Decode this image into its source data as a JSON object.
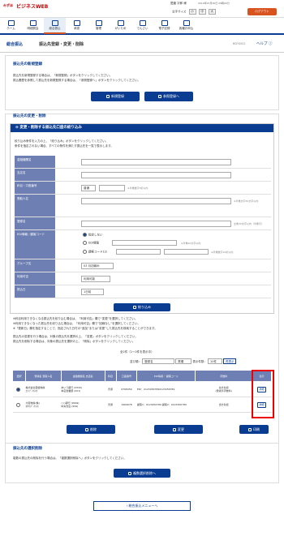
{
  "header": {
    "logo_sub": "みずほ",
    "logo": "ビジネスWEB",
    "user": "愛媛 次郎 様",
    "date": "2014年07月30日 09時00分",
    "font_size_label": "文字サイズ",
    "font_sizes": [
      "小",
      "中",
      "大"
    ],
    "logout": "ログアウト"
  },
  "nav": [
    "ホーム",
    "明細照会",
    "総合振込",
    "承認",
    "管理",
    "がいため",
    "でんさい",
    "電子記録",
    "各種お申込"
  ],
  "page": {
    "breadcrumb": "総合振込",
    "title": "振込先登録・変更・削除",
    "code": "BSFK002",
    "help": "ヘルプ"
  },
  "new_section": {
    "heading": "振込先の新規登録",
    "line1": "振込先を新規登録する場合は、「新規登録」ボタンをクリックしてください。",
    "line2": "振込履歴を参照して振込先を新規登録する場合は、「参照登録へ」ボタンをクリックしてください。",
    "btn_new": "新規登録",
    "btn_ref": "参照登録へ"
  },
  "edit_section": {
    "heading": "振込先の変更・削除",
    "filter_title": "変更・削除する振込先口座の絞り込み",
    "filter_line1": "絞り込み条件を入力の上、「絞り込み」ボタンをクリックしてください。",
    "filter_line2": "条件を指定されない場合、すべての条件を満たす振込先を一覧で表示します。",
    "fields": {
      "bank": "金融機関名",
      "branch": "支店名",
      "account_label": "科目・口座番号",
      "account_select": "普通",
      "account_note": "※半角数字7桁以内",
      "payee_name": "受取人名",
      "payee_note": "※半角文字30文字以内",
      "reg_name": "登録名",
      "reg_note": "全角30文字以内（半角可）",
      "edi_label": "EDI情報／顧客コード",
      "edi_opt1": "指定しない",
      "edi_opt2": "EDI情報",
      "edi_opt3": "顧客コード1/2",
      "edi_note2": "※半角20文字以内",
      "edi_note3": "※半角数字10桁以内",
      "group": "グループ名",
      "group_val": "03 月初締め",
      "usage": "利用可否",
      "usage_val": "利用可能",
      "transfer_date": "振込日",
      "transfer_val": "1日前"
    },
    "filter_btn": "絞り込み",
    "notice1": "※科目利用できなくなる振込先を絞り込む場合は、「利用可否」欄で“変更”を選択してください。",
    "notice2": "※利用できなくなった振込先を絞り込む場合は、「利用可否」欄で“回線なし”を選択してください。",
    "notice3": "※「更新日」欄を指定することで、指定された日付の“追加”または“変更”した振込先を検索することができます。",
    "select_line1": "振込先の変更を行う場合は、対象の振込先を選択の上、「変更」ボタンをクリックしてください。",
    "select_line2": "振込先を削除する場合は、対象の振込先を選択の上、「削除」ボタンをクリックしてください。",
    "count_text": "全2件（1～2件を表示中）",
    "sort_label": "並び順：",
    "sort_val": "登録名",
    "sort_dir": "昇順",
    "per_page_label": "表示件数：",
    "per_page_val": "10件",
    "redisplay": "再表示"
  },
  "table": {
    "headers": [
      "選択",
      "登録名\n受取人名",
      "金融機関名\n支店名",
      "科目",
      "口座番号",
      "EDI情報／\n顧客コード",
      "手数料",
      "表示"
    ],
    "rows": [
      {
        "name": "株式会社愛媛物産",
        "kana": "ｴﾋﾒﾌﾞｯｻﾝ(ｶ",
        "bank": "あいう銀行 (0542)",
        "branch": "本店営業部 (001)",
        "type": "普通",
        "account": "6768459",
        "edi": "EDI：01234567890123456789",
        "fee": "先方負担",
        "fee2": "(登録済手数料)",
        "detail": "詳細",
        "selected": true
      },
      {
        "name": "大阪物産(株)",
        "kana": "ｵｵｻｶﾌﾞｯｻﾝ(ｶ",
        "bank": "○○銀行 (9999)",
        "branch": "中央支店 (999)",
        "type": "普通",
        "account": "1969678",
        "edi": "顧客1：0123456789 顧客2：0123456789",
        "fee": "当方負担",
        "fee2": "",
        "detail": "詳細",
        "selected": false
      }
    ]
  },
  "actions": {
    "delete": "削除",
    "change": "変更",
    "print": "印刷"
  },
  "bulk_section": {
    "heading": "振込先の選択削除",
    "line": "複数の振込先の削除を行う場合は、「複数選択削除へ」ボタンをクリックしてください。",
    "btn": "複数選択削除へ"
  },
  "back": "総合振込メニューへ"
}
